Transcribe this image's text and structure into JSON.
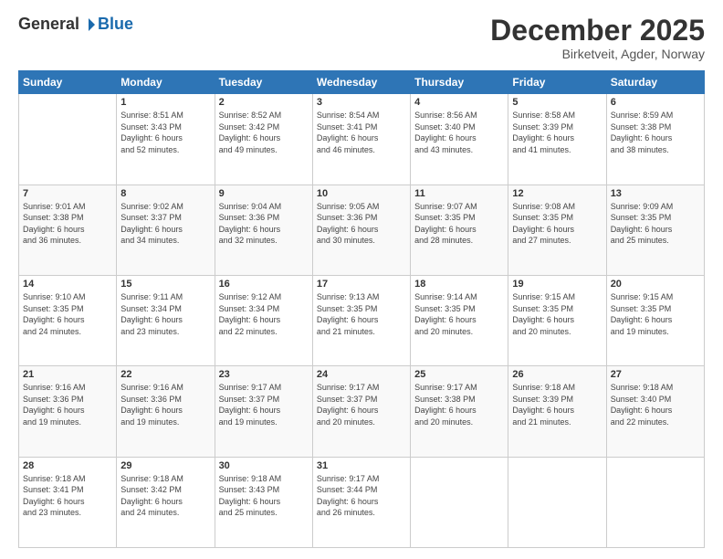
{
  "logo": {
    "general": "General",
    "blue": "Blue"
  },
  "title": "December 2025",
  "location": "Birketveit, Agder, Norway",
  "days_header": [
    "Sunday",
    "Monday",
    "Tuesday",
    "Wednesday",
    "Thursday",
    "Friday",
    "Saturday"
  ],
  "weeks": [
    [
      {
        "day": "",
        "info": ""
      },
      {
        "day": "1",
        "info": "Sunrise: 8:51 AM\nSunset: 3:43 PM\nDaylight: 6 hours\nand 52 minutes."
      },
      {
        "day": "2",
        "info": "Sunrise: 8:52 AM\nSunset: 3:42 PM\nDaylight: 6 hours\nand 49 minutes."
      },
      {
        "day": "3",
        "info": "Sunrise: 8:54 AM\nSunset: 3:41 PM\nDaylight: 6 hours\nand 46 minutes."
      },
      {
        "day": "4",
        "info": "Sunrise: 8:56 AM\nSunset: 3:40 PM\nDaylight: 6 hours\nand 43 minutes."
      },
      {
        "day": "5",
        "info": "Sunrise: 8:58 AM\nSunset: 3:39 PM\nDaylight: 6 hours\nand 41 minutes."
      },
      {
        "day": "6",
        "info": "Sunrise: 8:59 AM\nSunset: 3:38 PM\nDaylight: 6 hours\nand 38 minutes."
      }
    ],
    [
      {
        "day": "7",
        "info": "Sunrise: 9:01 AM\nSunset: 3:38 PM\nDaylight: 6 hours\nand 36 minutes."
      },
      {
        "day": "8",
        "info": "Sunrise: 9:02 AM\nSunset: 3:37 PM\nDaylight: 6 hours\nand 34 minutes."
      },
      {
        "day": "9",
        "info": "Sunrise: 9:04 AM\nSunset: 3:36 PM\nDaylight: 6 hours\nand 32 minutes."
      },
      {
        "day": "10",
        "info": "Sunrise: 9:05 AM\nSunset: 3:36 PM\nDaylight: 6 hours\nand 30 minutes."
      },
      {
        "day": "11",
        "info": "Sunrise: 9:07 AM\nSunset: 3:35 PM\nDaylight: 6 hours\nand 28 minutes."
      },
      {
        "day": "12",
        "info": "Sunrise: 9:08 AM\nSunset: 3:35 PM\nDaylight: 6 hours\nand 27 minutes."
      },
      {
        "day": "13",
        "info": "Sunrise: 9:09 AM\nSunset: 3:35 PM\nDaylight: 6 hours\nand 25 minutes."
      }
    ],
    [
      {
        "day": "14",
        "info": "Sunrise: 9:10 AM\nSunset: 3:35 PM\nDaylight: 6 hours\nand 24 minutes."
      },
      {
        "day": "15",
        "info": "Sunrise: 9:11 AM\nSunset: 3:34 PM\nDaylight: 6 hours\nand 23 minutes."
      },
      {
        "day": "16",
        "info": "Sunrise: 9:12 AM\nSunset: 3:34 PM\nDaylight: 6 hours\nand 22 minutes."
      },
      {
        "day": "17",
        "info": "Sunrise: 9:13 AM\nSunset: 3:35 PM\nDaylight: 6 hours\nand 21 minutes."
      },
      {
        "day": "18",
        "info": "Sunrise: 9:14 AM\nSunset: 3:35 PM\nDaylight: 6 hours\nand 20 minutes."
      },
      {
        "day": "19",
        "info": "Sunrise: 9:15 AM\nSunset: 3:35 PM\nDaylight: 6 hours\nand 20 minutes."
      },
      {
        "day": "20",
        "info": "Sunrise: 9:15 AM\nSunset: 3:35 PM\nDaylight: 6 hours\nand 19 minutes."
      }
    ],
    [
      {
        "day": "21",
        "info": "Sunrise: 9:16 AM\nSunset: 3:36 PM\nDaylight: 6 hours\nand 19 minutes."
      },
      {
        "day": "22",
        "info": "Sunrise: 9:16 AM\nSunset: 3:36 PM\nDaylight: 6 hours\nand 19 minutes."
      },
      {
        "day": "23",
        "info": "Sunrise: 9:17 AM\nSunset: 3:37 PM\nDaylight: 6 hours\nand 19 minutes."
      },
      {
        "day": "24",
        "info": "Sunrise: 9:17 AM\nSunset: 3:37 PM\nDaylight: 6 hours\nand 20 minutes."
      },
      {
        "day": "25",
        "info": "Sunrise: 9:17 AM\nSunset: 3:38 PM\nDaylight: 6 hours\nand 20 minutes."
      },
      {
        "day": "26",
        "info": "Sunrise: 9:18 AM\nSunset: 3:39 PM\nDaylight: 6 hours\nand 21 minutes."
      },
      {
        "day": "27",
        "info": "Sunrise: 9:18 AM\nSunset: 3:40 PM\nDaylight: 6 hours\nand 22 minutes."
      }
    ],
    [
      {
        "day": "28",
        "info": "Sunrise: 9:18 AM\nSunset: 3:41 PM\nDaylight: 6 hours\nand 23 minutes."
      },
      {
        "day": "29",
        "info": "Sunrise: 9:18 AM\nSunset: 3:42 PM\nDaylight: 6 hours\nand 24 minutes."
      },
      {
        "day": "30",
        "info": "Sunrise: 9:18 AM\nSunset: 3:43 PM\nDaylight: 6 hours\nand 25 minutes."
      },
      {
        "day": "31",
        "info": "Sunrise: 9:17 AM\nSunset: 3:44 PM\nDaylight: 6 hours\nand 26 minutes."
      },
      {
        "day": "",
        "info": ""
      },
      {
        "day": "",
        "info": ""
      },
      {
        "day": "",
        "info": ""
      }
    ]
  ]
}
